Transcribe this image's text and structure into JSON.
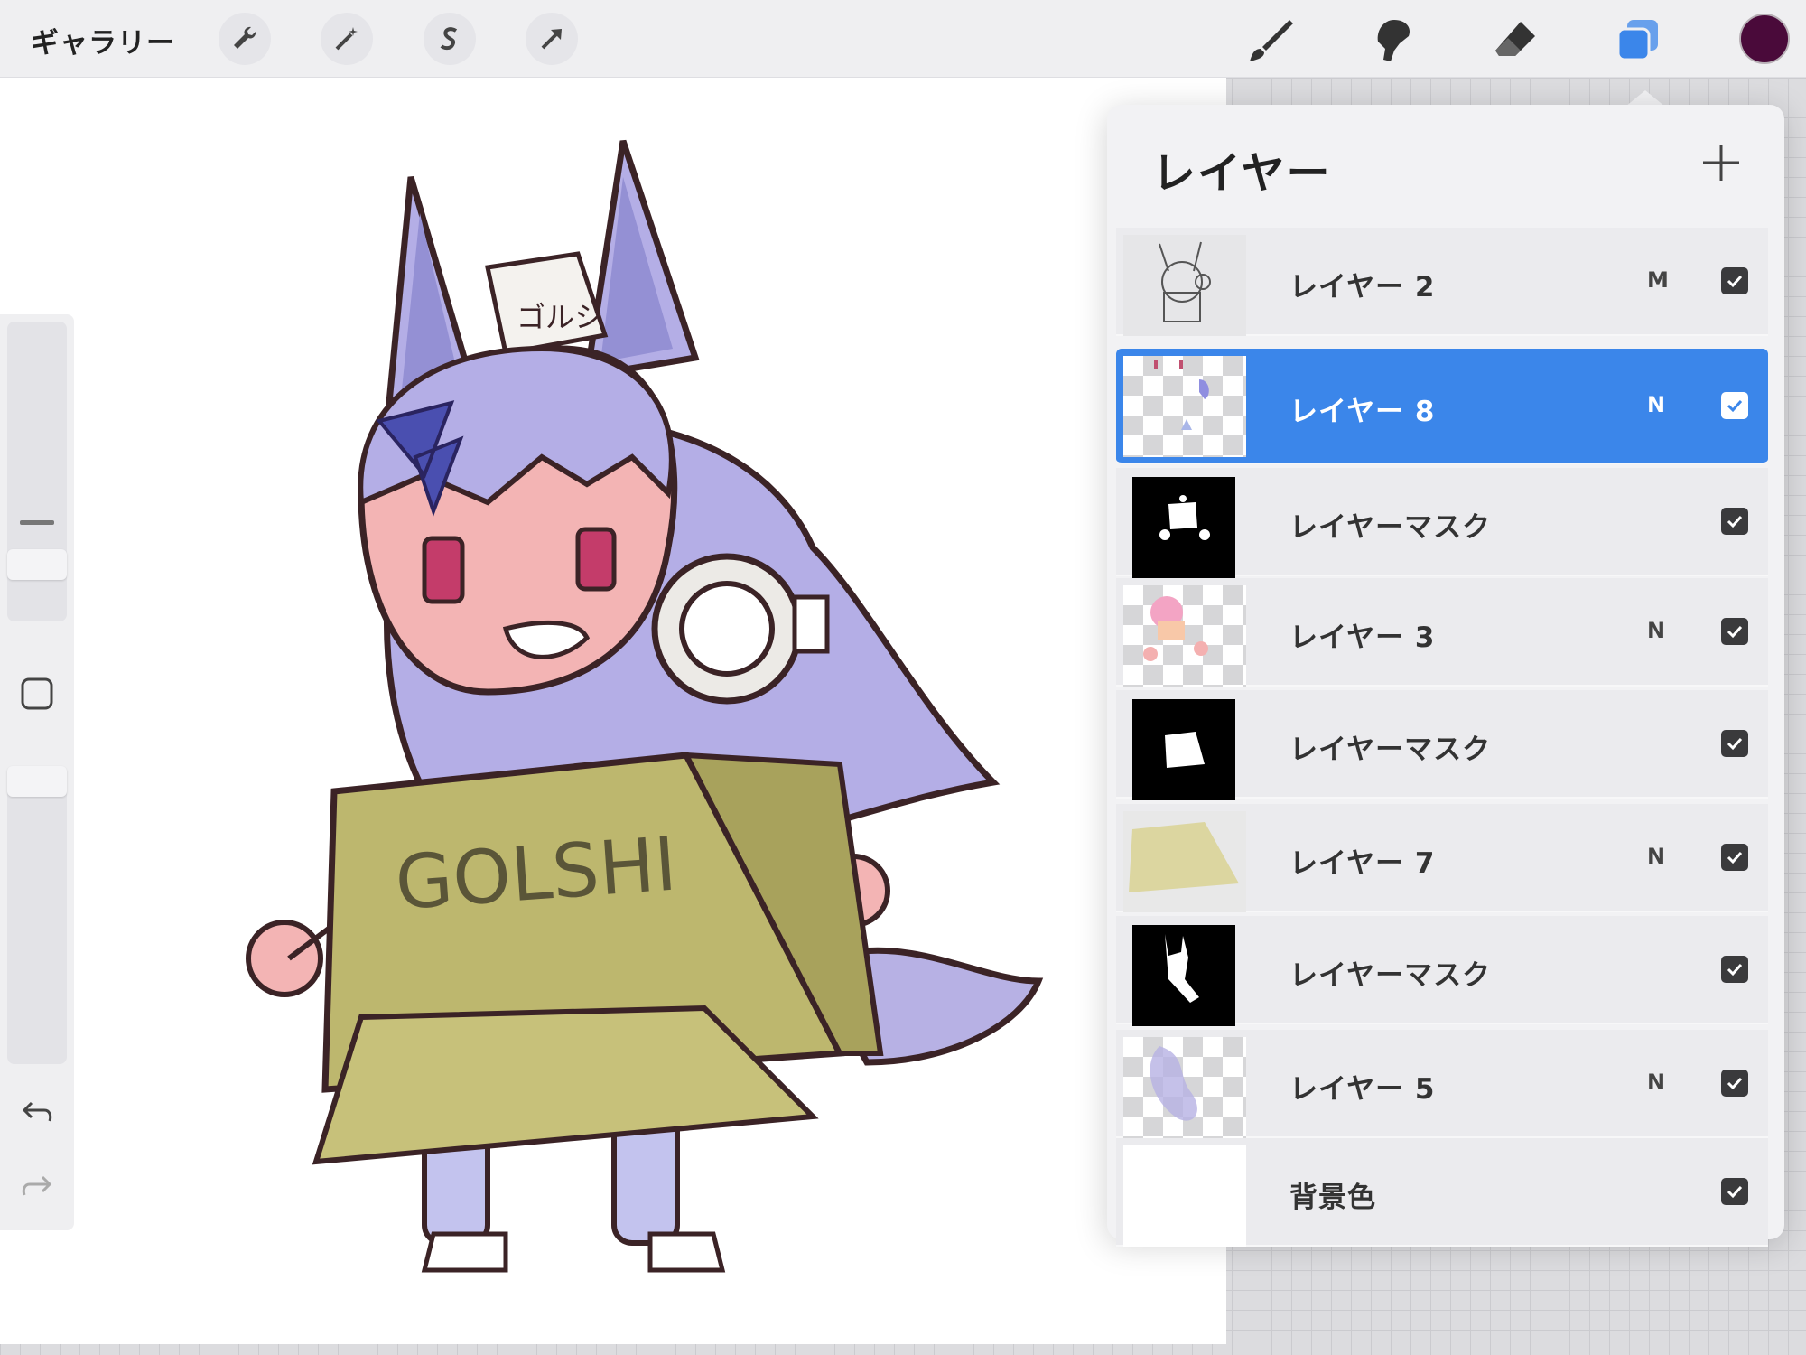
{
  "topbar": {
    "gallery_label": "ギャラリー",
    "tools": [
      "wrench-icon",
      "magic-wand-icon",
      "selection-s-icon",
      "transform-arrow-icon"
    ],
    "right_tools": [
      "brush-icon",
      "smudge-icon",
      "eraser-icon",
      "layers-icon"
    ],
    "active_color": "#4a0a3a",
    "accent": "#3b86ea"
  },
  "artwork": {
    "box_text": "GOLSHI",
    "hat_text": "ゴルシ"
  },
  "layers_panel": {
    "title": "レイヤー",
    "add_label": "+",
    "layers": [
      {
        "name": "レイヤー 2",
        "mode": "M",
        "visible": true,
        "selected": false
      },
      {
        "name": "レイヤー 8",
        "mode": "N",
        "visible": true,
        "selected": true
      },
      {
        "name": "レイヤーマスク",
        "mode": "",
        "visible": true,
        "selected": false
      },
      {
        "name": "レイヤー 3",
        "mode": "N",
        "visible": true,
        "selected": false
      },
      {
        "name": "レイヤーマスク",
        "mode": "",
        "visible": true,
        "selected": false
      },
      {
        "name": "レイヤー 7",
        "mode": "N",
        "visible": true,
        "selected": false
      },
      {
        "name": "レイヤーマスク",
        "mode": "",
        "visible": true,
        "selected": false
      },
      {
        "name": "レイヤー 5",
        "mode": "N",
        "visible": true,
        "selected": false
      },
      {
        "name": "背景色",
        "mode": "",
        "visible": true,
        "selected": false
      }
    ]
  },
  "sidebar": {
    "undo_icon": "undo-icon",
    "redo_icon": "redo-icon",
    "modify_icon": "square-icon"
  }
}
